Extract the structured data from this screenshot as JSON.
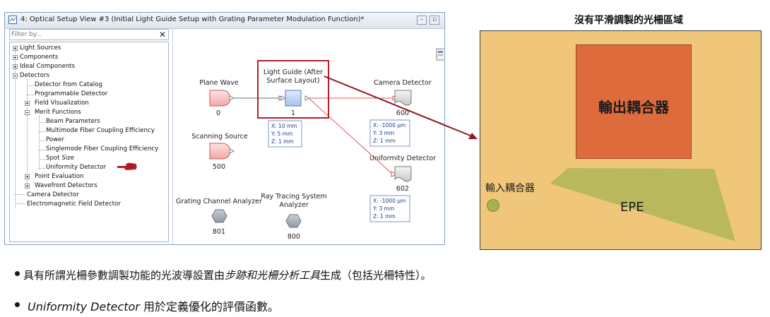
{
  "window": {
    "title": "4: Optical Setup View #3 (Initial Light Guide Setup with Grating Parameter Modulation Function)*",
    "filter_placeholder": "Filter by...",
    "filter_clear": "✕"
  },
  "tree": {
    "light_sources": "Light Sources",
    "components": "Components",
    "ideal_components": "Ideal Components",
    "detectors": "Detectors",
    "detector_from_catalog": "Detector from Catalog",
    "programmable_detector": "Programmable Detector",
    "field_visualization": "Field Visualization",
    "merit_functions": "Merit Functions",
    "beam_parameters": "Beam Parameters",
    "multimode_fiber": "Multimode Fiber Coupling Efficiency",
    "power": "Power",
    "singlemode_fiber": "Singlemode Fiber Coupling Efficiency",
    "spot_size": "Spot Size",
    "uniformity_detector": "Uniformity Detector",
    "point_evaluation": "Point Evaluation",
    "wavefront_detectors": "Wavefront Detectors",
    "camera_detector": "Camera Detector",
    "em_field_detector": "Electromagnetic Field Detector"
  },
  "setup": {
    "plane_wave": {
      "label": "Plane Wave",
      "id": "0"
    },
    "scanning_source": {
      "label": "Scanning Source",
      "id": "500"
    },
    "light_guide": {
      "label_line1": "Light Guide (After",
      "label_line2": "Surface Layout)",
      "id": "1",
      "pos": {
        "x": "X: 10 mm",
        "y": "Y: 5 mm",
        "z": "Z: 1 mm"
      }
    },
    "camera_detector": {
      "label": "Camera Detector",
      "id": "600",
      "pos": {
        "x": "X: -1000 μm",
        "y": "Y: 3 mm",
        "z": "Z: 1 mm"
      }
    },
    "uniformity_detector": {
      "label": "Uniformity Detector",
      "id": "602",
      "pos": {
        "x": "X: -1000 μm",
        "y": "Y: 3 mm",
        "z": "Z: 1 mm"
      }
    },
    "grating_analyzer": {
      "label": "Grating Channel Analyzer",
      "id": "801"
    },
    "ray_tracing_analyzer": {
      "label_line1": "Ray Tracing System",
      "label_line2": "Analyzer",
      "id": "800"
    }
  },
  "diagram": {
    "title": "沒有平滑調製的光柵區域",
    "outcoupler": "輸出耦合器",
    "incoupler": "輸入耦合器",
    "epe": "EPE",
    "colors": {
      "background": "#f0c77a",
      "outcoupler": "#dd6b3c",
      "epe": "#b9b85e",
      "incoupler": "#a7b24f",
      "highlight": "#b3202a"
    }
  },
  "bullets": [
    {
      "before": "具有所謂光柵參數調製功能的光波導設置由",
      "italic": "步跡和光柵分析工具",
      "after": "生成（包括光柵特性）。"
    },
    {
      "before": "",
      "italic": "Uniformity Detector",
      "after": " 用於定義優化的評價函數。"
    }
  ]
}
